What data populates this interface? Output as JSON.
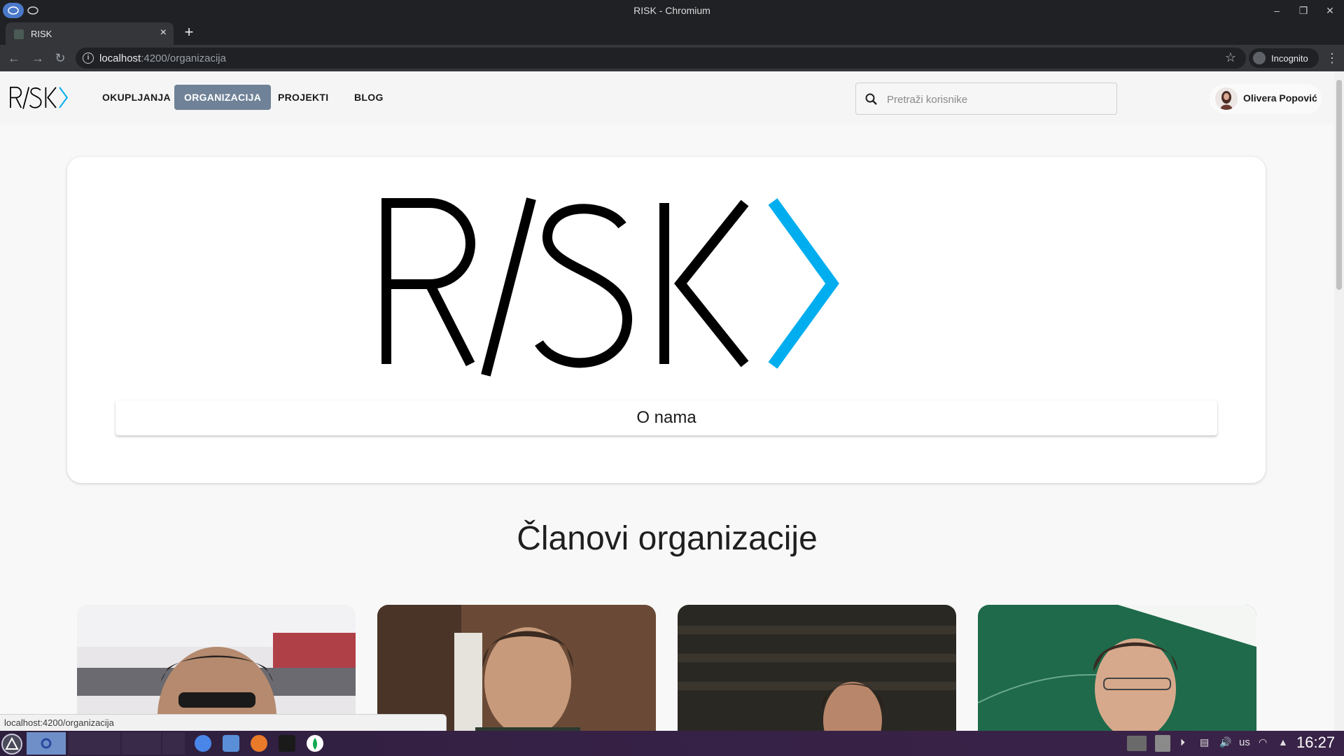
{
  "window": {
    "title": "RISK - Chromium"
  },
  "tab": {
    "title": "RISK",
    "close": "×",
    "new_tab": "+"
  },
  "omnibox": {
    "host": "localhost",
    "path": ":4200/organizacija",
    "info": "i",
    "star": "☆"
  },
  "incognito": {
    "label": "Incognito"
  },
  "nav": {
    "items": [
      {
        "label": "OKUPLJANJA",
        "active": false
      },
      {
        "label": "ORGANIZACIJA",
        "active": true
      },
      {
        "label": "PROJEKTI",
        "active": false
      },
      {
        "label": "BLOG",
        "active": false
      }
    ]
  },
  "search": {
    "placeholder": "Pretraži korisnike",
    "value": ""
  },
  "user": {
    "name": "Olivera Popović"
  },
  "hero": {
    "about_button": "O nama"
  },
  "members_section": {
    "title": "Članovi organizacije"
  },
  "status_bar": {
    "url": "localhost:4200/organizacija"
  },
  "taskbar": {
    "keyboard_layout": "us",
    "clock": "16:27"
  },
  "colors": {
    "accent_blue": "#00aeef",
    "nav_active": "#6f8297",
    "logo_black": "#000000"
  },
  "icons": [
    "back-icon",
    "forward-icon",
    "reload-icon",
    "info-icon",
    "star-icon",
    "incognito-icon",
    "menu-icon",
    "search-icon",
    "avatar",
    "minimize-icon",
    "restore-icon",
    "close-icon"
  ]
}
